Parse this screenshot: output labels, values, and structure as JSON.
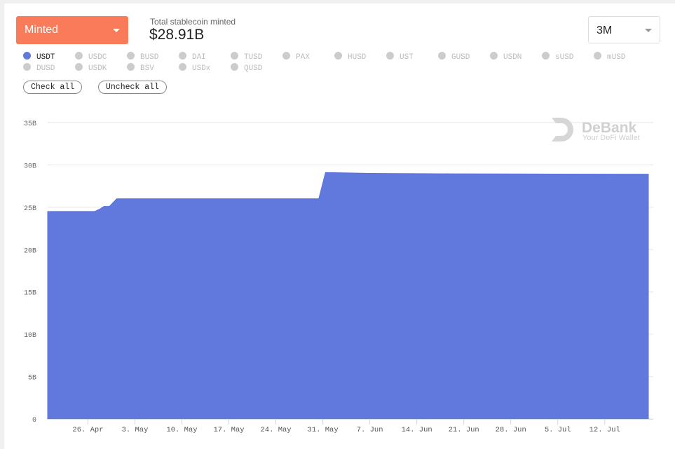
{
  "metric_select": {
    "value": "Minted"
  },
  "total": {
    "label": "Total stablecoin minted",
    "value": "$28.91B"
  },
  "range_select": {
    "value": "3M"
  },
  "legend": [
    {
      "label": "USDT",
      "active": true
    },
    {
      "label": "USDC",
      "active": false
    },
    {
      "label": "BUSD",
      "active": false
    },
    {
      "label": "DAI",
      "active": false
    },
    {
      "label": "TUSD",
      "active": false
    },
    {
      "label": "PAX",
      "active": false
    },
    {
      "label": "HUSD",
      "active": false
    },
    {
      "label": "UST",
      "active": false
    },
    {
      "label": "GUSD",
      "active": false
    },
    {
      "label": "USDN",
      "active": false
    },
    {
      "label": "sUSD",
      "active": false
    },
    {
      "label": "mUSD",
      "active": false
    },
    {
      "label": "DUSD",
      "active": false
    },
    {
      "label": "USDK",
      "active": false
    },
    {
      "label": "BSV",
      "active": false
    },
    {
      "label": "USDx",
      "active": false
    },
    {
      "label": "QUSD",
      "active": false
    }
  ],
  "buttons": {
    "check_all": "Check all",
    "uncheck_all": "Uncheck all"
  },
  "watermark": {
    "brand": "DeBank",
    "tagline": "Your DeFi Wallet"
  },
  "colors": {
    "accent": "#f97b59",
    "series": "#6179dd"
  },
  "chart_data": {
    "type": "area",
    "title": "",
    "xlabel": "",
    "ylabel": "",
    "ylim": [
      0,
      35
    ],
    "y_unit": "B",
    "y_ticks": [
      "0",
      "5B",
      "10B",
      "15B",
      "20B",
      "25B",
      "30B",
      "35B"
    ],
    "y_tick_values": [
      0,
      5,
      10,
      15,
      20,
      25,
      30,
      35
    ],
    "x_tick_labels": [
      "26. Apr",
      "3. May",
      "10. May",
      "17. May",
      "24. May",
      "31. May",
      "7. Jun",
      "14. Jun",
      "21. Jun",
      "28. Jun",
      "5. Jul",
      "12. Jul"
    ],
    "x_tick_days": [
      6,
      13,
      20,
      27,
      34,
      41,
      48,
      55,
      62,
      69,
      76,
      83
    ],
    "x_range_days": [
      0,
      89.5
    ],
    "grid": true,
    "legend_position": "top-left",
    "series": [
      {
        "name": "USDT",
        "points": [
          [
            0,
            24.5
          ],
          [
            7.0,
            24.5
          ],
          [
            7.8,
            24.8
          ],
          [
            8.4,
            25.1
          ],
          [
            9.2,
            25.1
          ],
          [
            10.3,
            26.0
          ],
          [
            20,
            26.0
          ],
          [
            30,
            26.0
          ],
          [
            40.4,
            26.0
          ],
          [
            41.4,
            29.1
          ],
          [
            48,
            29.0
          ],
          [
            60,
            28.95
          ],
          [
            75,
            28.92
          ],
          [
            89.5,
            28.91
          ]
        ]
      }
    ]
  }
}
